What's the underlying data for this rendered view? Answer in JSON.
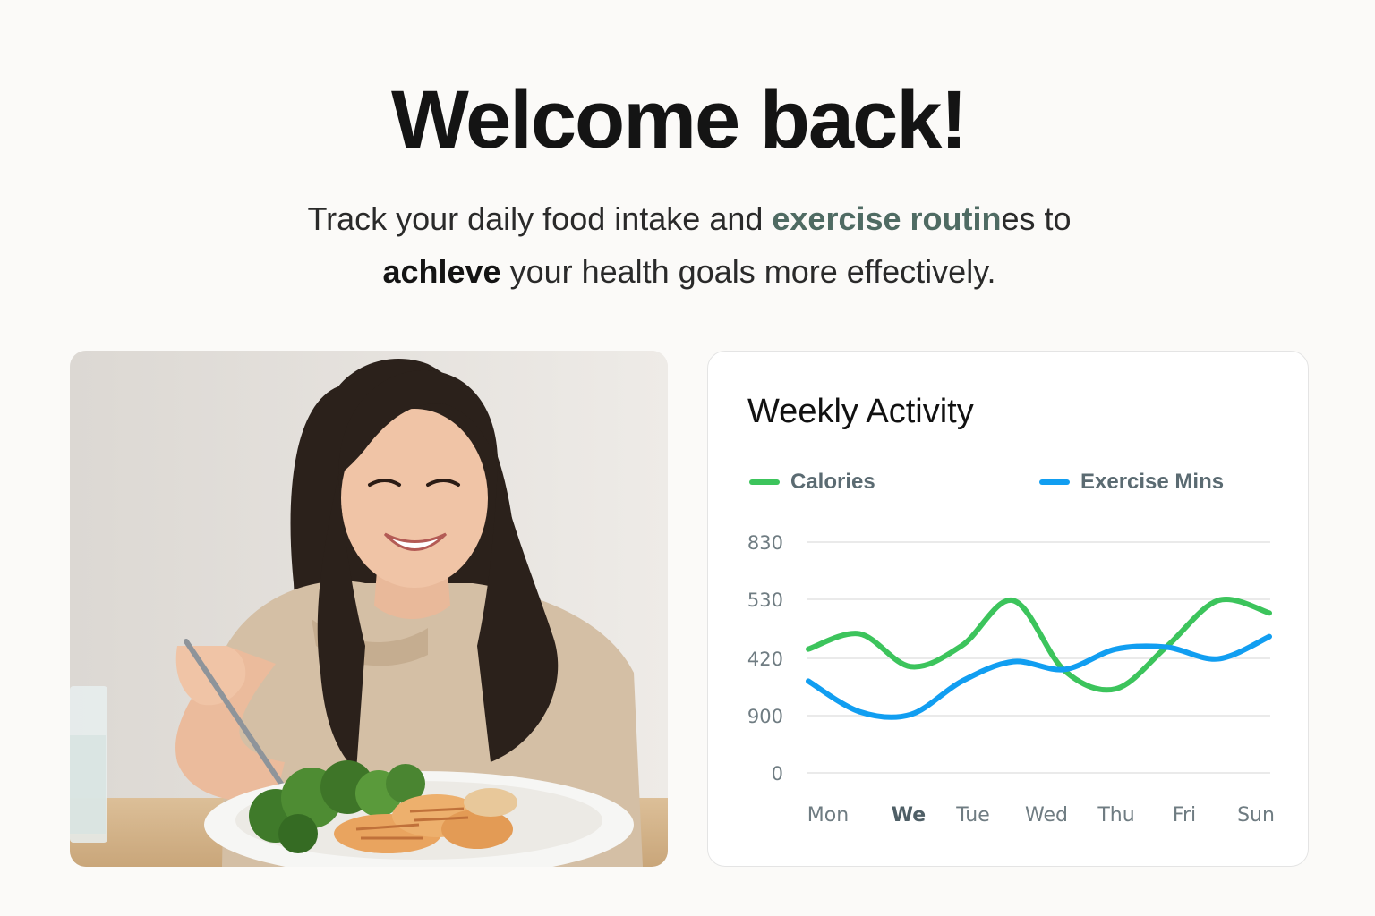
{
  "hero": {
    "title": "Welcome back!",
    "subtitle_line1_pre": "Track your daily food intake and ",
    "subtitle_line1_hl": "exercise routin",
    "subtitle_line1_post": "es to",
    "subtitle_line2_strong": "achleve",
    "subtitle_line2_post": " your health goals more effectively."
  },
  "colors": {
    "calories": "#3cc45c",
    "exercise": "#119ef1",
    "accent_text": "#4f6b63"
  },
  "chart_data": {
    "type": "line",
    "title": "Weekly Activity",
    "categories": [
      "Mon",
      "We",
      "Tue",
      "Wed",
      "Thu",
      "Fri",
      "Sun"
    ],
    "y_ticks": [
      "830",
      "530",
      "420",
      "900",
      "0"
    ],
    "series": [
      {
        "name": "Calories",
        "color": "#3cc45c",
        "values": [
          445,
          500,
          382,
          458,
          620,
          368,
          302,
          455,
          620,
          575
        ]
      },
      {
        "name": "Exercise Mins",
        "color": "#119ef1",
        "values": [
          330,
          220,
          210,
          330,
          400,
          372,
          445,
          452,
          410,
          490
        ]
      }
    ],
    "legend_position": "top",
    "grid": true
  }
}
